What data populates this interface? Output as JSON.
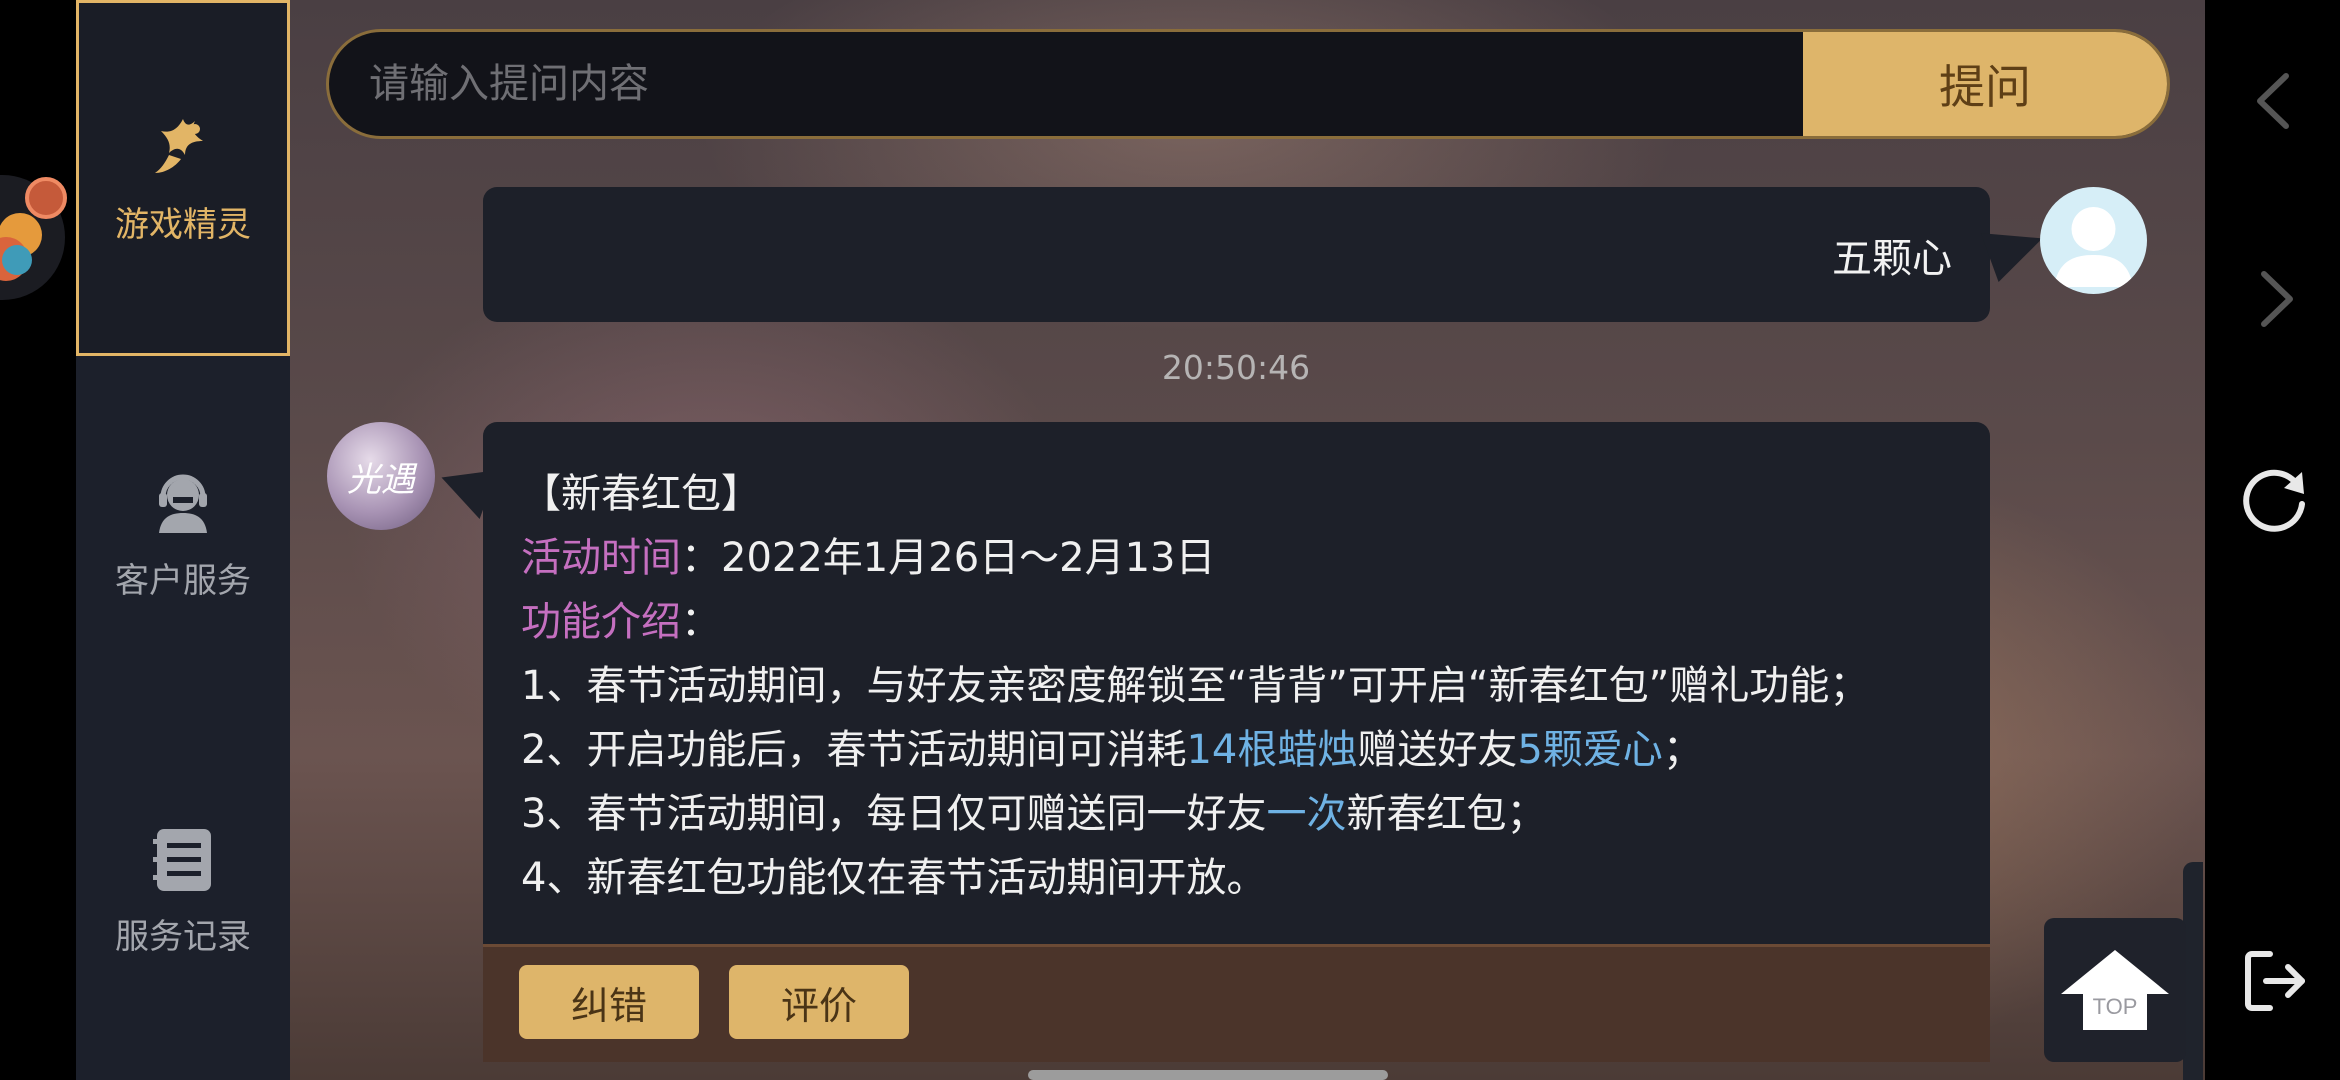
{
  "sidebar": {
    "items": [
      {
        "label": "游戏精灵",
        "icon": "fairy-icon",
        "active": true
      },
      {
        "label": "客户服务",
        "icon": "customer-service-icon",
        "active": false
      },
      {
        "label": "服务记录",
        "icon": "service-record-icon",
        "active": false
      }
    ]
  },
  "search": {
    "placeholder": "请输入提问内容",
    "button_label": "提问"
  },
  "chat": {
    "user_message": "五颗心",
    "timestamp": "20:50:46",
    "bot_avatar_text": "光遇",
    "bot_message": {
      "title": "【新春红包】",
      "time_label": "活动时间",
      "time_value": "：2022年1月26日～2月13日",
      "intro_label": "功能介绍",
      "intro_colon": "：",
      "line1": "1、春节活动期间，与好友亲密度解锁至“背背”可开启“新春红包”赠礼功能；",
      "line2_a": "2、开启功能后，春节活动期间可消耗",
      "line2_b": "14根蜡烛",
      "line2_c": "赠送好友",
      "line2_d": "5颗爱心",
      "line2_e": "；",
      "line3_a": "3、春节活动期间，每日仅可赠送同一好友",
      "line3_b": "一次",
      "line3_c": "新春红包；",
      "line4": "4、新春红包功能仅在春节活动期间开放。"
    },
    "feedback_buttons": {
      "correct": "纠错",
      "rate": "评价"
    }
  },
  "top_button": {
    "label": "TOP"
  },
  "right_nav": [
    "back-icon",
    "forward-icon",
    "refresh-icon",
    "exit-icon"
  ],
  "colors": {
    "accent": "#deb56a",
    "highlight_pink": "#c56fc0",
    "highlight_blue": "#6fb2e4"
  }
}
